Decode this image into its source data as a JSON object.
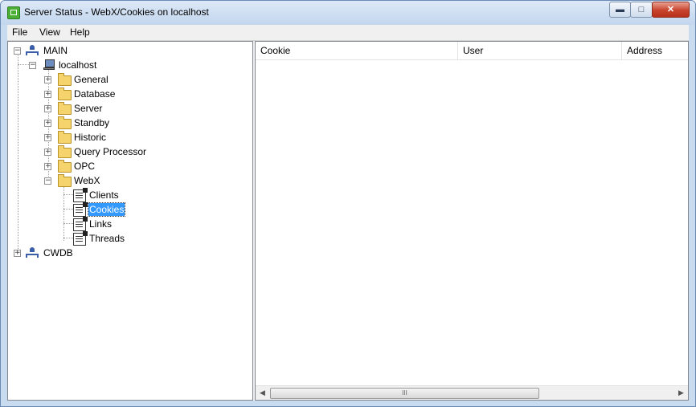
{
  "window": {
    "title": "Server Status - WebX/Cookies on localhost"
  },
  "menu": [
    "File",
    "View",
    "Help"
  ],
  "tree": {
    "main": "MAIN",
    "localhost": "localhost",
    "folders": [
      "General",
      "Database",
      "Server",
      "Standby",
      "Historic",
      "Query Processor",
      "OPC",
      "WebX"
    ],
    "webx_children": [
      "Clients",
      "Cookies",
      "Links",
      "Threads"
    ],
    "selected": "Cookies",
    "cwdb": "CWDB"
  },
  "list": {
    "columns": [
      "Cookie",
      "User",
      "Address"
    ],
    "rows": []
  },
  "scrollbar": {
    "grip": "III"
  },
  "colors": {
    "selection": "#3399ff",
    "title_gradient": "#c2d6ee"
  }
}
